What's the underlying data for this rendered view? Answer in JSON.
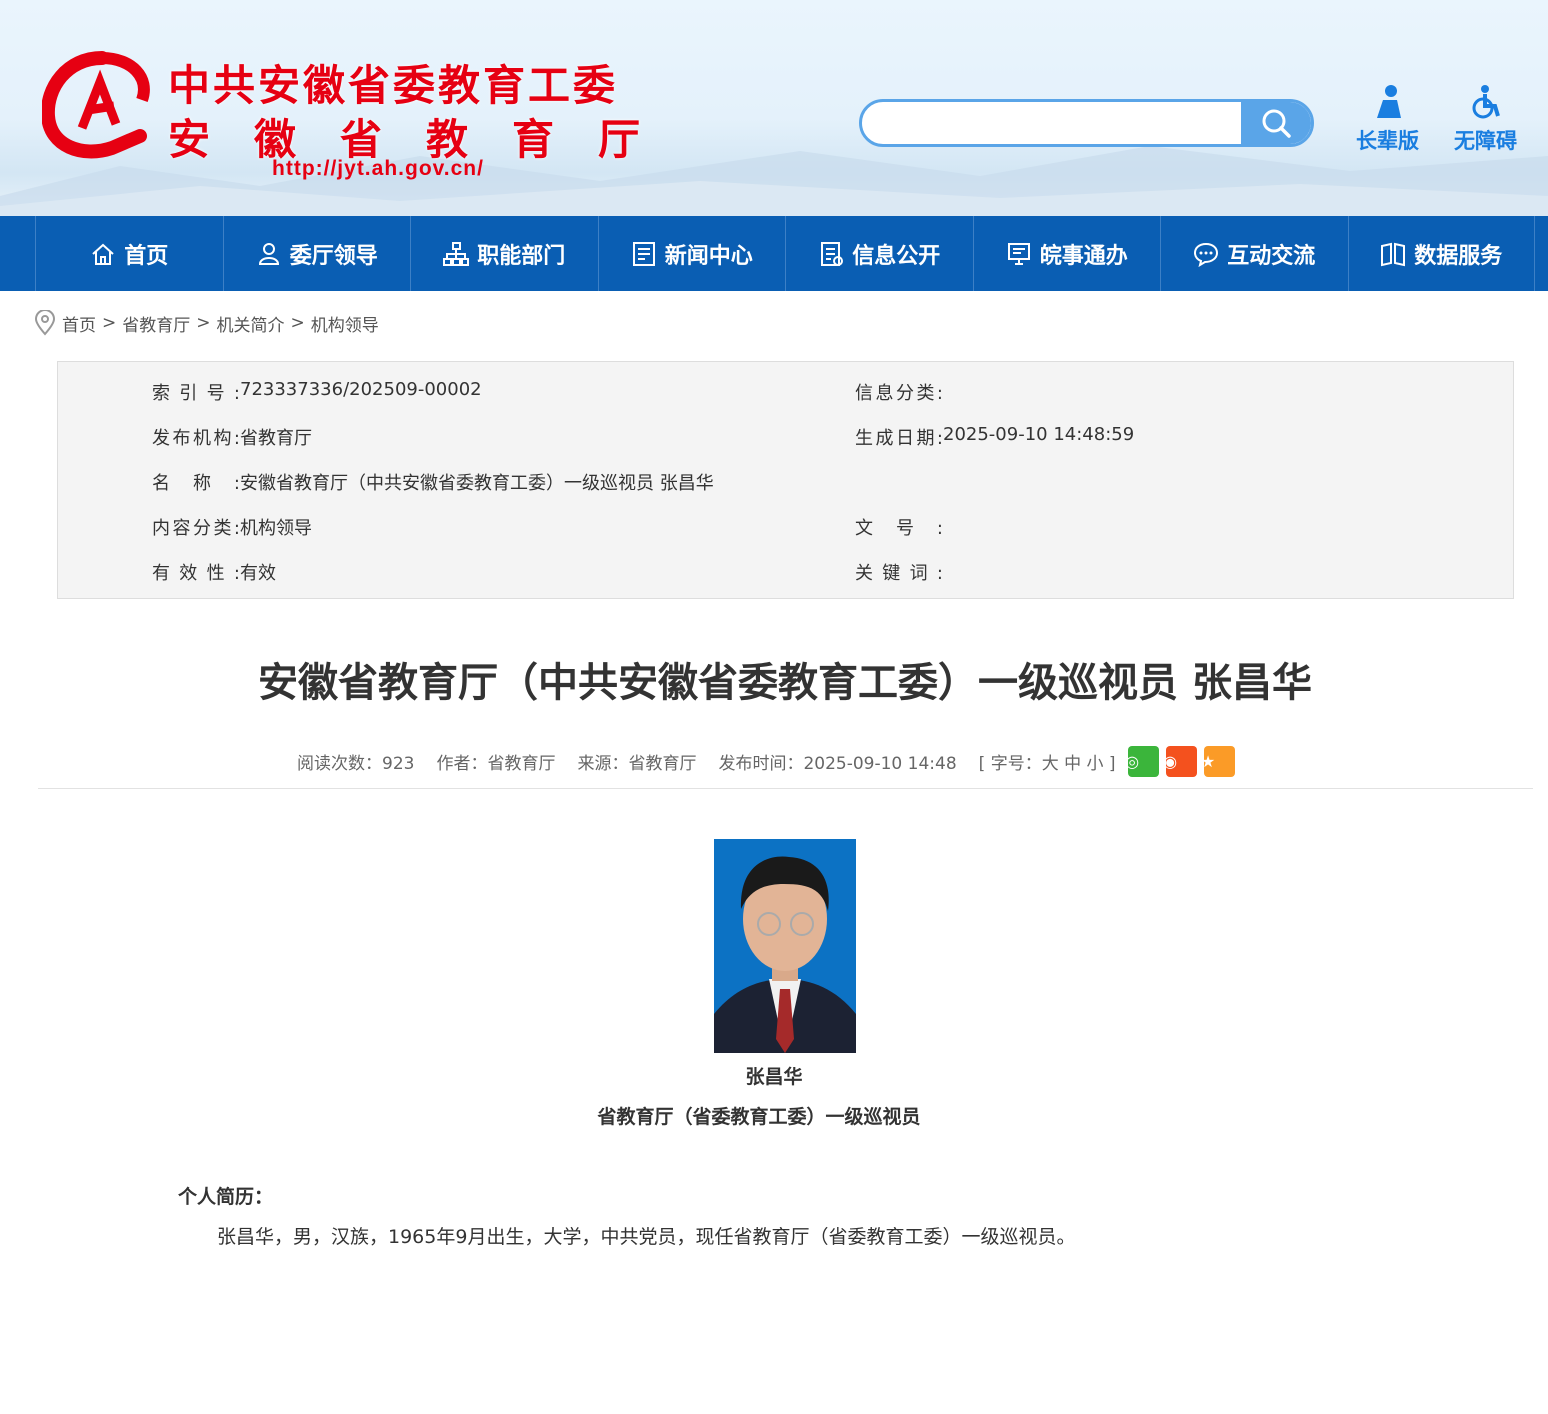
{
  "header": {
    "logo_line1": "中共安徽省委教育工委",
    "logo_line2": "安徽省教育厅",
    "logo_url": "http://jyt.ah.gov.cn/",
    "search_placeholder": "",
    "tools": [
      {
        "label": "长辈版",
        "icon": "elder-icon"
      },
      {
        "label": "无障碍",
        "icon": "wheelchair-icon"
      }
    ]
  },
  "nav": [
    {
      "label": "首页",
      "icon": "home-icon"
    },
    {
      "label": "委厅领导",
      "icon": "people-icon"
    },
    {
      "label": "职能部门",
      "icon": "org-chart-icon"
    },
    {
      "label": "新闻中心",
      "icon": "news-icon"
    },
    {
      "label": "信息公开",
      "icon": "document-icon"
    },
    {
      "label": "皖事通办",
      "icon": "monitor-icon"
    },
    {
      "label": "互动交流",
      "icon": "chat-icon"
    },
    {
      "label": "数据服务",
      "icon": "book-icon"
    }
  ],
  "breadcrumb": [
    "首页",
    "省教育厅",
    "机关简介",
    "机构领导"
  ],
  "breadcrumb_sep": ">",
  "info": {
    "index_label": "索引号:",
    "index": "723337336/202509-00002",
    "category_label": "信息分类:",
    "category": "",
    "publisher_label": "发布机构:",
    "publisher": "省教育厅",
    "date_label": "生成日期:",
    "date": "2025-09-10 14:48:59",
    "name_label": "名称:",
    "name": "安徽省教育厅（中共安徽省委教育工委）一级巡视员 张昌华",
    "content_cat_label": "内容分类:",
    "content_cat": "机构领导",
    "doc_no_label": "文号:",
    "doc_no": "",
    "validity_label": "有效性:",
    "validity": "有效",
    "keywords_label": "关键词:",
    "keywords": ""
  },
  "article": {
    "title": "安徽省教育厅（中共安徽省委教育工委）一级巡视员 张昌华",
    "meta": {
      "reads": "阅读次数：923",
      "author": "作者：省教育厅",
      "source": "来源：省教育厅",
      "published": "发布时间：2025-09-10 14:48",
      "font_size": "[ 字号：大 中 小 ]"
    },
    "person_name": "张昌华",
    "person_title": "省教育厅（省委教育工委）一级巡视员",
    "section_heading": "个人简历：",
    "bio": "张昌华，男，汉族，1965年9月出生，大学，中共党员，现任省教育厅（省委教育工委）一级巡视员。"
  },
  "colors": {
    "nav": "#0a5eb3",
    "logo_red": "#e60012",
    "accent": "#1a7ee0"
  }
}
